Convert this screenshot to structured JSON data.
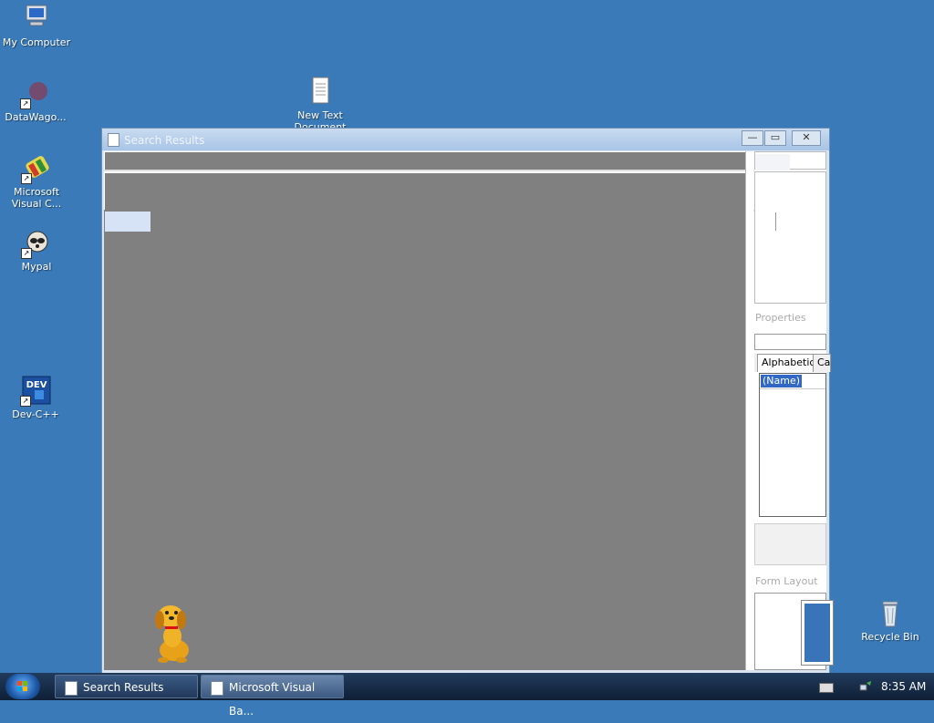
{
  "desktop": {
    "icons": [
      {
        "label": "My Computer",
        "icon": "computer-icon"
      },
      {
        "label": "DataWago...",
        "icon": "datawagon-icon"
      },
      {
        "label": "Microsoft Visual C...",
        "icon": "visual-c-icon"
      },
      {
        "label": "Mypal",
        "icon": "mypal-icon"
      },
      {
        "label": "Dev-C++",
        "icon": "devcpp-icon",
        "badge": "DEV"
      },
      {
        "label": "New Text Document",
        "icon": "text-document-icon"
      },
      {
        "label": "Recycle Bin",
        "icon": "recycle-bin-icon"
      }
    ]
  },
  "window": {
    "title": "Search Results",
    "controls": {
      "minimize": "—",
      "maximize": "▭",
      "close": "✕"
    }
  },
  "ide": {
    "properties_title": "Properties",
    "tabs": [
      "Alphabetic",
      "Ca"
    ],
    "selected_property": "(Name)",
    "form_layout_title": "Form Layout"
  },
  "taskbar": {
    "items": [
      {
        "label": "Search Results"
      },
      {
        "label": "Microsoft Visual Ba..."
      }
    ],
    "clock": "8:35 AM"
  },
  "colors": {
    "desktop": "#3a7ab8",
    "workspace": "#808080",
    "selection": "#3168c6"
  }
}
